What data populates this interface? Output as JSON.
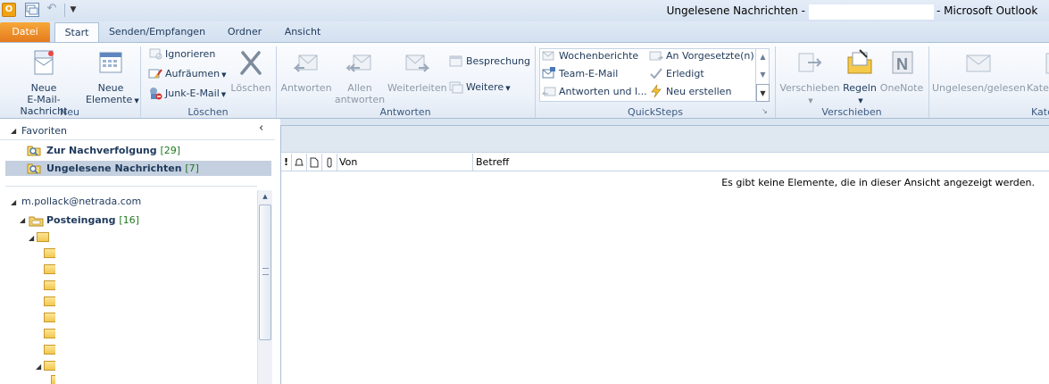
{
  "window": {
    "title_left": "Ungelesene Nachrichten -",
    "title_right": "- Microsoft Outlook",
    "app_icon_label": "O"
  },
  "tabs": [
    {
      "label": "Datei"
    },
    {
      "label": "Start"
    },
    {
      "label": "Senden/Empfangen"
    },
    {
      "label": "Ordner"
    },
    {
      "label": "Ansicht"
    }
  ],
  "ribbon": {
    "neu": {
      "group_label": "Neu",
      "new_email": {
        "line1": "Neue",
        "line2": "E-Mail-Nachricht"
      },
      "new_items": {
        "line1": "Neue",
        "line2": "Elemente"
      }
    },
    "loeschen": {
      "group_label": "Löschen",
      "ignorieren": "Ignorieren",
      "aufraeumen": "Aufräumen",
      "junk": "Junk-E-Mail",
      "loeschen_btn": "Löschen"
    },
    "antworten": {
      "group_label": "Antworten",
      "antworten_btn": "Antworten",
      "allen": {
        "line1": "Allen",
        "line2": "antworten"
      },
      "weiterleiten": "Weiterleiten",
      "besprechung": "Besprechung",
      "weitere": "Weitere"
    },
    "quicksteps": {
      "group_label": "QuickSteps",
      "items": [
        "Wochenberichte",
        "An Vorgesetzte(n)",
        "Team-E-Mail",
        "Erledigt",
        "Antworten und l...",
        "Neu erstellen"
      ]
    },
    "verschieben": {
      "group_label": "Verschieben",
      "verschieben_btn": "Verschieben",
      "regeln": "Regeln",
      "onenote": "OneNote"
    },
    "markierungen": {
      "ungelesen": "Ungelesen/gelesen",
      "kategorisieren_partial": "Kate",
      "group_label_partial": "Kate"
    }
  },
  "nav": {
    "favorites_header": "Favoriten",
    "collapse_icon": "chevron-left",
    "favorites": [
      {
        "label": "Zur Nachverfolgung",
        "count": "[29]",
        "selected": false
      },
      {
        "label": "Ungelesene Nachrichten",
        "count": "[7]",
        "selected": true
      }
    ],
    "account": "m.pollack@netrada.com",
    "inbox": {
      "label": "Posteingang",
      "count": "[16]"
    }
  },
  "mail_list": {
    "columns": [
      "!",
      "",
      "",
      "",
      "Von",
      "Betreff"
    ],
    "column_icons": [
      "importance-icon",
      "reminder-icon",
      "icon-column-icon",
      "attachment-icon"
    ],
    "empty_message": "Es gibt keine Elemente, die in dieser Ansicht angezeigt werden."
  },
  "colors": {
    "accent_orange": "#e5781c",
    "ribbon_text": "#1e395b",
    "count_green": "#1f7a1f",
    "selection": "#c4d0df"
  }
}
